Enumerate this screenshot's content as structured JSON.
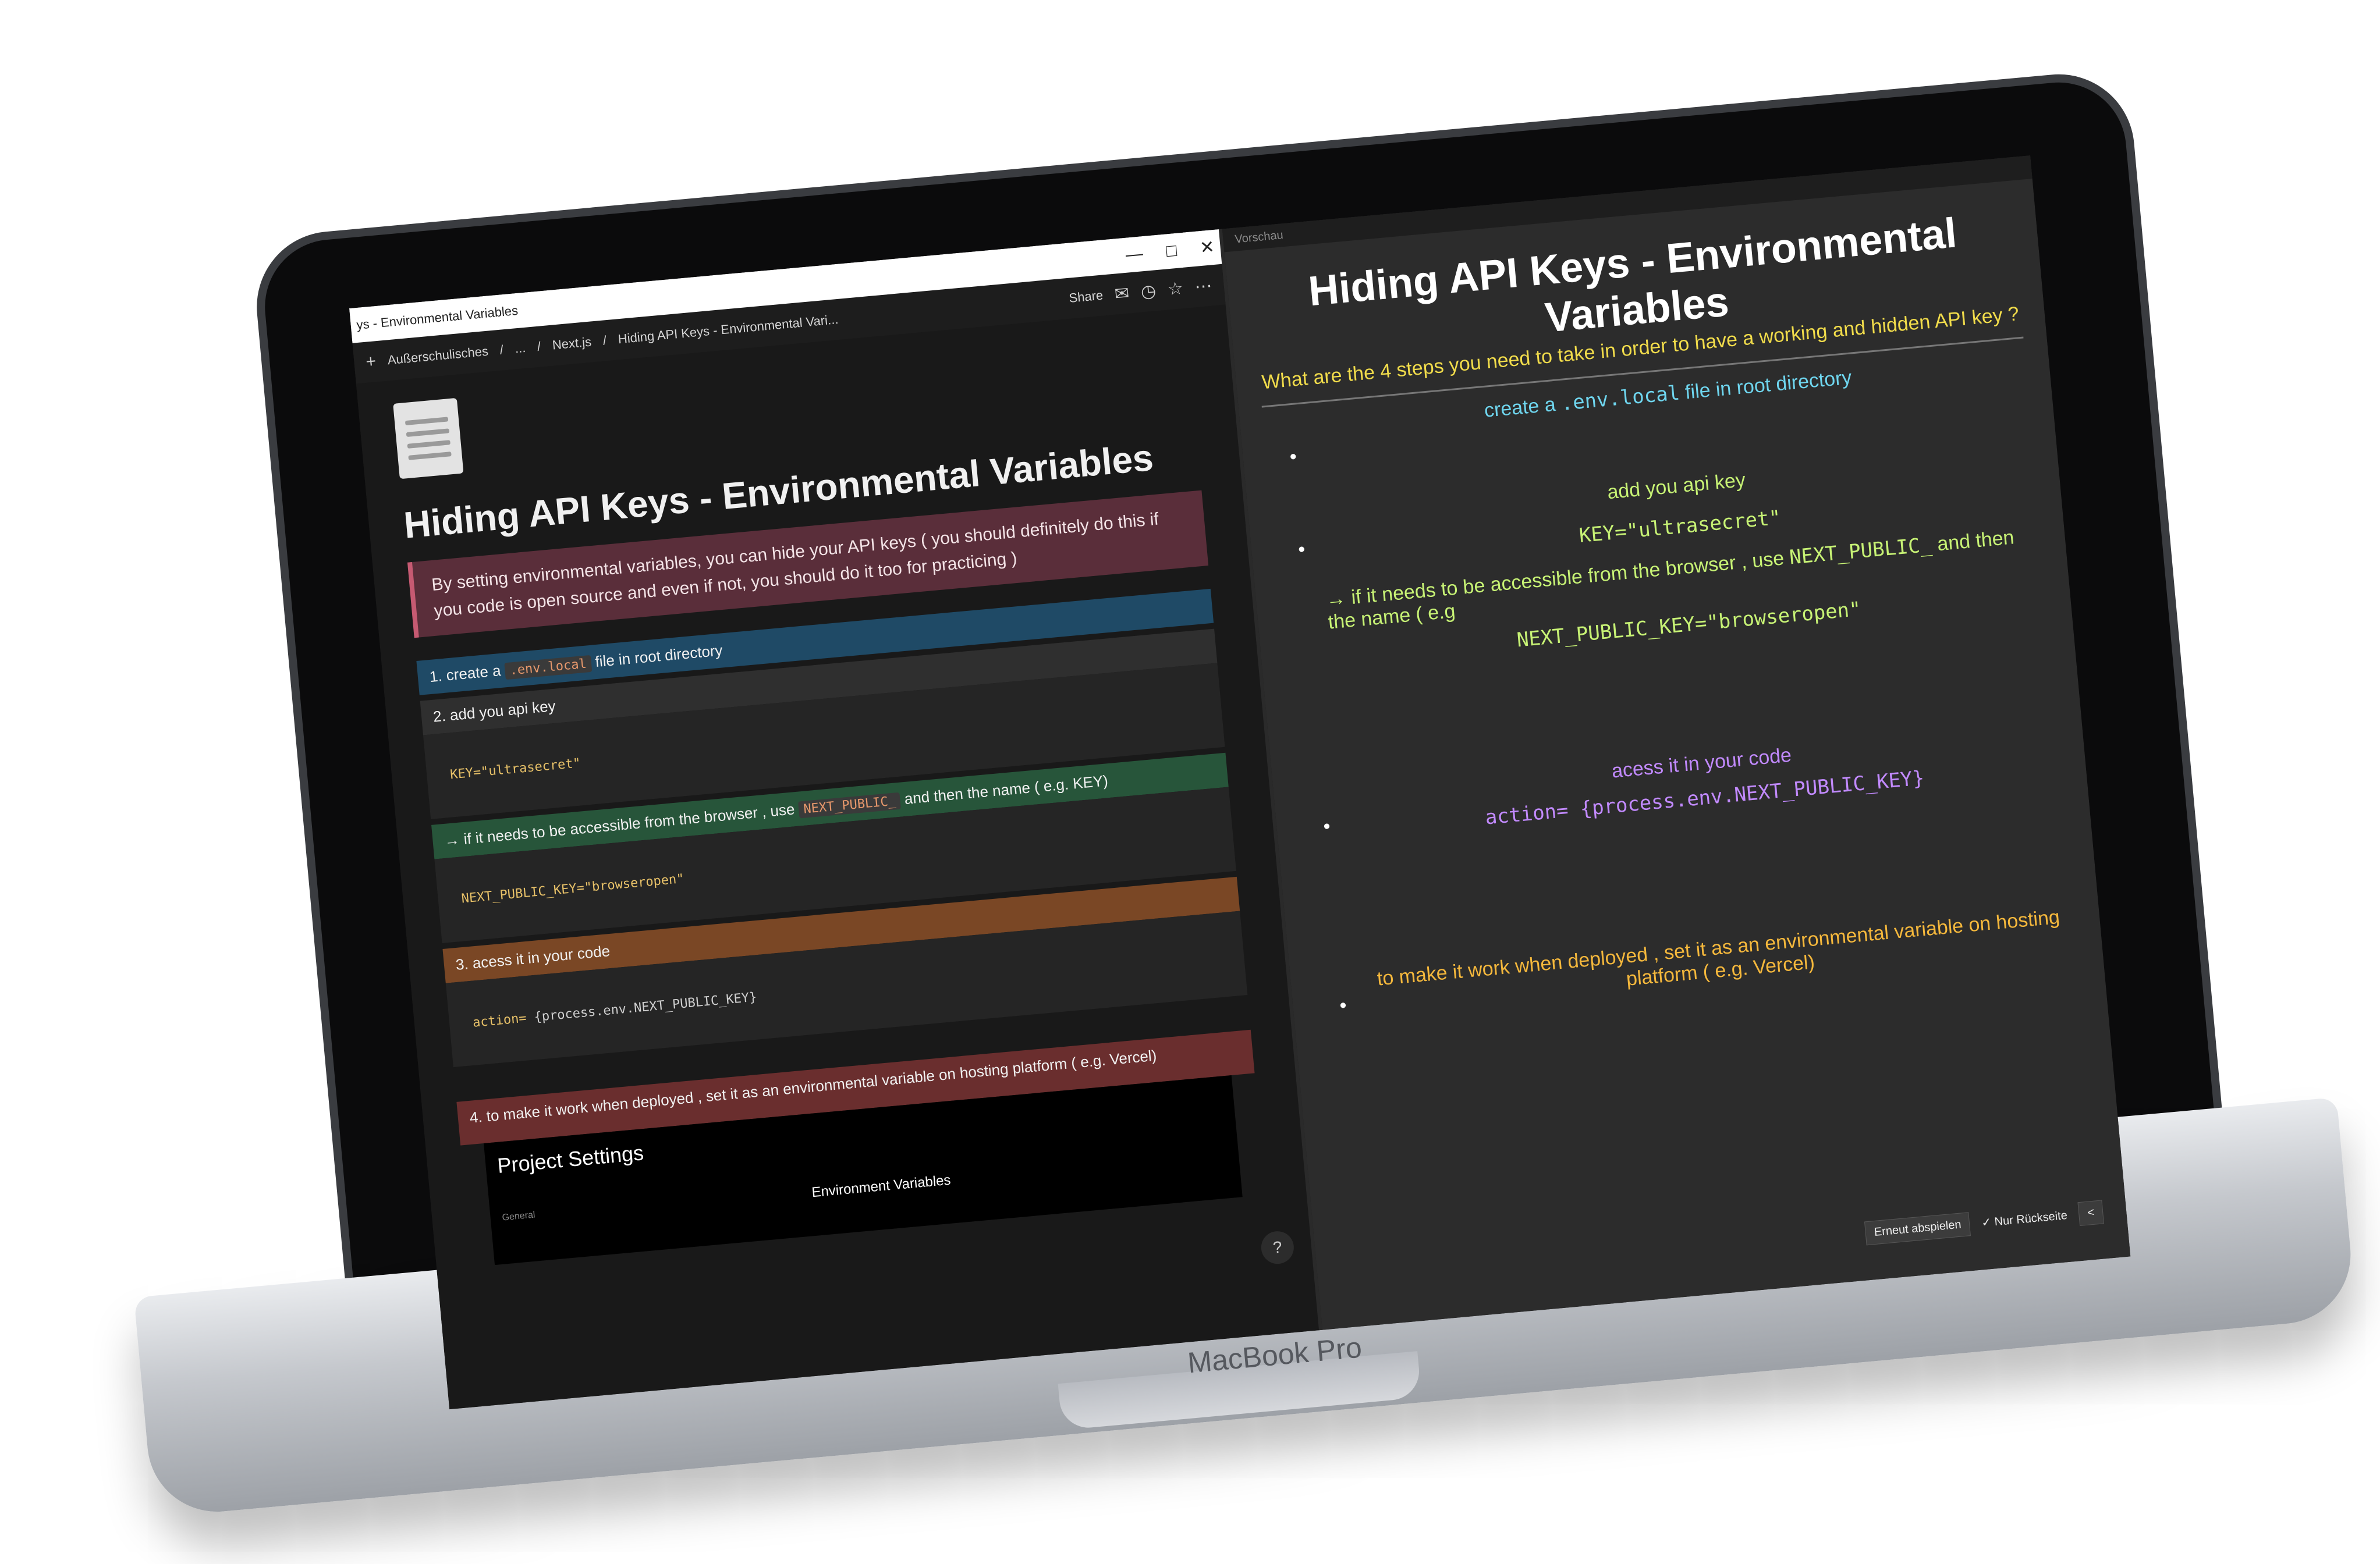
{
  "device": {
    "brand_label": "MacBook Pro"
  },
  "notion": {
    "window_title": "ys - Environmental Variables",
    "window_controls": [
      "—",
      "□",
      "✕"
    ],
    "breadcrumb": [
      "Außerschulisches",
      "...",
      "Next.js",
      "Hiding API Keys - Environmental Vari..."
    ],
    "toolbar": {
      "share_label": "Share"
    },
    "page": {
      "title": "Hiding API Keys - Environmental Variables",
      "callout": "By setting environmental variables, you can hide your API  keys ( you should definitely do this if you code is open source and even if not, you should do it too for practicing )",
      "step1_prefix": "1.  create a",
      "step1_code": ".env.local",
      "step1_suffix": "file in root directory",
      "step2": "2.  add you api key",
      "code1": "KEY=\"ultrasecret\"",
      "browser_note_prefix": "→ if it needs to be accessible from the browser , use",
      "browser_note_code": "NEXT_PUBLIC_",
      "browser_note_suffix": "and then the name ( e.g. KEY)",
      "code2": "NEXT_PUBLIC_KEY=\"browseropen\"",
      "step3": "3.  acess it in your code",
      "code3_key": "action=",
      "code3_val": "{process.env.NEXT_PUBLIC_KEY}",
      "step4": "4.  to make it work when deployed , set it as an environmental variable on hosting platform ( e.g. Vercel)",
      "embed_title": "Project Settings",
      "embed_general": "General",
      "embed_env": "Environment Variables",
      "help": "?"
    }
  },
  "preview": {
    "window_title": "Vorschau",
    "card_title": "Hiding API Keys - Environmental Variables",
    "question": "What are the 4 steps you need to take in order to have a working and hidden API key ?",
    "a1_prefix": "create a",
    "a1_code": ".env.local",
    "a1_suffix": "file in root directory",
    "a2": "add you api key",
    "a2_code": "KEY=\"ultrasecret\"",
    "a2_note_prefix": "→ if it needs to be accessible from the browser , use",
    "a2_note_code": "NEXT_PUBLIC_",
    "a2_note_suffix": "and then the name ( e.g",
    "a2_code2": "NEXT_PUBLIC_KEY=\"browseropen\"",
    "a3": "acess it in your code",
    "a3_code": "action= {process.env.NEXT_PUBLIC_KEY}",
    "a4": "to make it work when deployed , set it as an environmental variable on hosting platform ( e.g. Vercel)",
    "replay_label": "Erneut abspielen",
    "backside_label": "Nur Rückseite",
    "back_arrow": "<"
  }
}
